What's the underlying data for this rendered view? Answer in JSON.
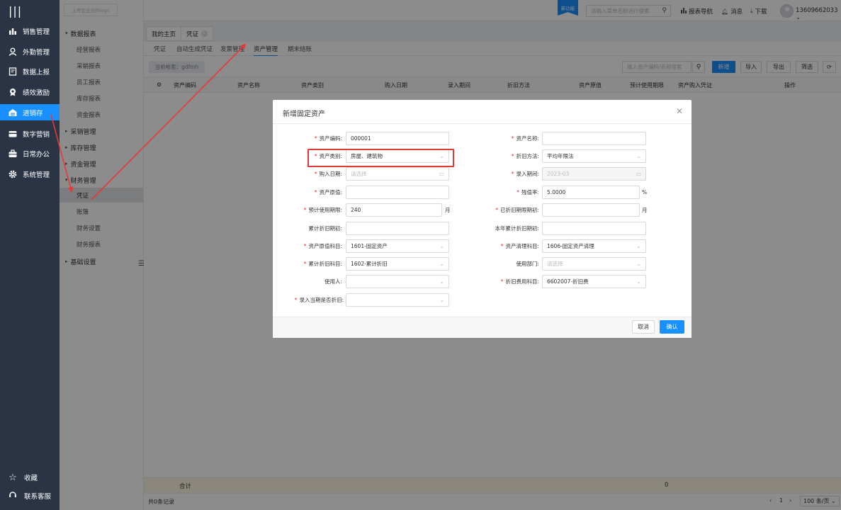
{
  "nav": {
    "items": [
      {
        "icon": "sales-chart-icon",
        "label": "销售管理"
      },
      {
        "icon": "attendance-person-icon",
        "label": "外勤管理"
      },
      {
        "icon": "report-doc-icon",
        "label": "数据上报"
      },
      {
        "icon": "incentive-medal-icon",
        "label": "绩效激励"
      },
      {
        "icon": "warehouse-icon",
        "label": "进销存"
      },
      {
        "icon": "marketing-card-icon",
        "label": "数字营销"
      },
      {
        "icon": "briefcase-icon",
        "label": "日常办公"
      },
      {
        "icon": "gear-icon",
        "label": "系统管理"
      }
    ],
    "active_index": 4,
    "favorites": "收藏",
    "support": "联系客服"
  },
  "subnav": {
    "logo_placeholder": "上传您企业的logo",
    "groups": [
      {
        "label": "数据报表",
        "expanded": true,
        "items": [
          "经营报表",
          "采销报表",
          "员工报表",
          "库存报表",
          "资金报表"
        ]
      },
      {
        "label": "采销管理",
        "expanded": false,
        "items": []
      },
      {
        "label": "库存管理",
        "expanded": false,
        "items": []
      },
      {
        "label": "资金管理",
        "expanded": false,
        "items": []
      },
      {
        "label": "财务管理",
        "expanded": true,
        "items": [
          "凭证",
          "账簿",
          "财务设置",
          "财务报表"
        ]
      },
      {
        "label": "基础设置",
        "expanded": false,
        "items": []
      }
    ],
    "active_item": "凭证"
  },
  "header": {
    "new_feature_badge": "新功能",
    "menu_search_placeholder": "请输入菜单名称进行搜索",
    "report_nav": "报表导航",
    "messages": "消息",
    "download": "下载",
    "username": "13609662033"
  },
  "tabs": [
    {
      "label": "我的主页",
      "closable": false
    },
    {
      "label": "凭证",
      "closable": true
    }
  ],
  "subtabs": {
    "items": [
      "凭证",
      "自动生成凭证",
      "发票管理",
      "资产管理",
      "期末结账"
    ],
    "active": "资产管理"
  },
  "toolbar": {
    "current_ledger": "当前帐套：gdfmh",
    "asset_search_placeholder": "输入资产编码/名称搜索",
    "add": "新增",
    "import": "导入",
    "export": "导出",
    "filter": "筛选"
  },
  "table": {
    "columns": [
      "资产编码",
      "资产名称",
      "资产类别",
      "购入日期",
      "录入期间",
      "折旧方法",
      "资产原值",
      "预计使用期限",
      "资产购入凭证",
      "操作"
    ],
    "rows": [],
    "footer_label": "合计",
    "footer_total": "0",
    "record_count": "共0条记录",
    "page": "1",
    "page_size": "100 条/页"
  },
  "modal": {
    "title": "新增固定资产",
    "fields": {
      "asset_code": {
        "label": "资产编码:",
        "required": true,
        "value": "000001"
      },
      "asset_name": {
        "label": "资产名称:",
        "required": true,
        "value": ""
      },
      "asset_category": {
        "label": "资产类别:",
        "required": true,
        "value": "房屋、建筑物"
      },
      "depreciation_method": {
        "label": "折旧方法:",
        "required": true,
        "value": "平均年限法"
      },
      "purchase_date": {
        "label": "购入日期:",
        "required": true,
        "placeholder": "请选择"
      },
      "entry_period": {
        "label": "录入期间:",
        "required": true,
        "value": "2023-03"
      },
      "original_value": {
        "label": "资产原值:",
        "required": true,
        "value": ""
      },
      "residual_rate": {
        "label": "残值率:",
        "required": true,
        "value": "5.0000",
        "unit": "%"
      },
      "useful_life": {
        "label": "预计使用期限:",
        "required": true,
        "value": "240",
        "unit": "月"
      },
      "depreciated_periods": {
        "label": "已折旧期限期初:",
        "required": true,
        "value": "",
        "unit": "月"
      },
      "accum_dep_opening": {
        "label": "累计折旧期初:",
        "required": false,
        "value": ""
      },
      "year_accum_dep_opening": {
        "label": "本年累计折旧期初:",
        "required": false,
        "value": ""
      },
      "original_value_account": {
        "label": "资产原值科目:",
        "required": true,
        "value": "1601-固定资产"
      },
      "disposal_account": {
        "label": "资产清理科目:",
        "required": true,
        "value": "1606-固定资产清理"
      },
      "accum_dep_account": {
        "label": "累计折旧科目:",
        "required": true,
        "value": "1602-累计折旧"
      },
      "department": {
        "label": "使用部门:",
        "required": false,
        "placeholder": "请选择"
      },
      "user": {
        "label": "使用人:",
        "required": false,
        "value": ""
      },
      "dep_expense_account": {
        "label": "折旧费用科目:",
        "required": true,
        "value": "6602007-折旧费"
      },
      "depreciate_this_period": {
        "label": "录入当期是否折旧:",
        "required": true,
        "value": ""
      }
    },
    "cancel": "取消",
    "confirm": "确认"
  },
  "colors": {
    "sidebar_bg": "#2a3444",
    "accent": "#1890ff",
    "annotation_red": "#e53935",
    "required_star": "#f5222d"
  }
}
